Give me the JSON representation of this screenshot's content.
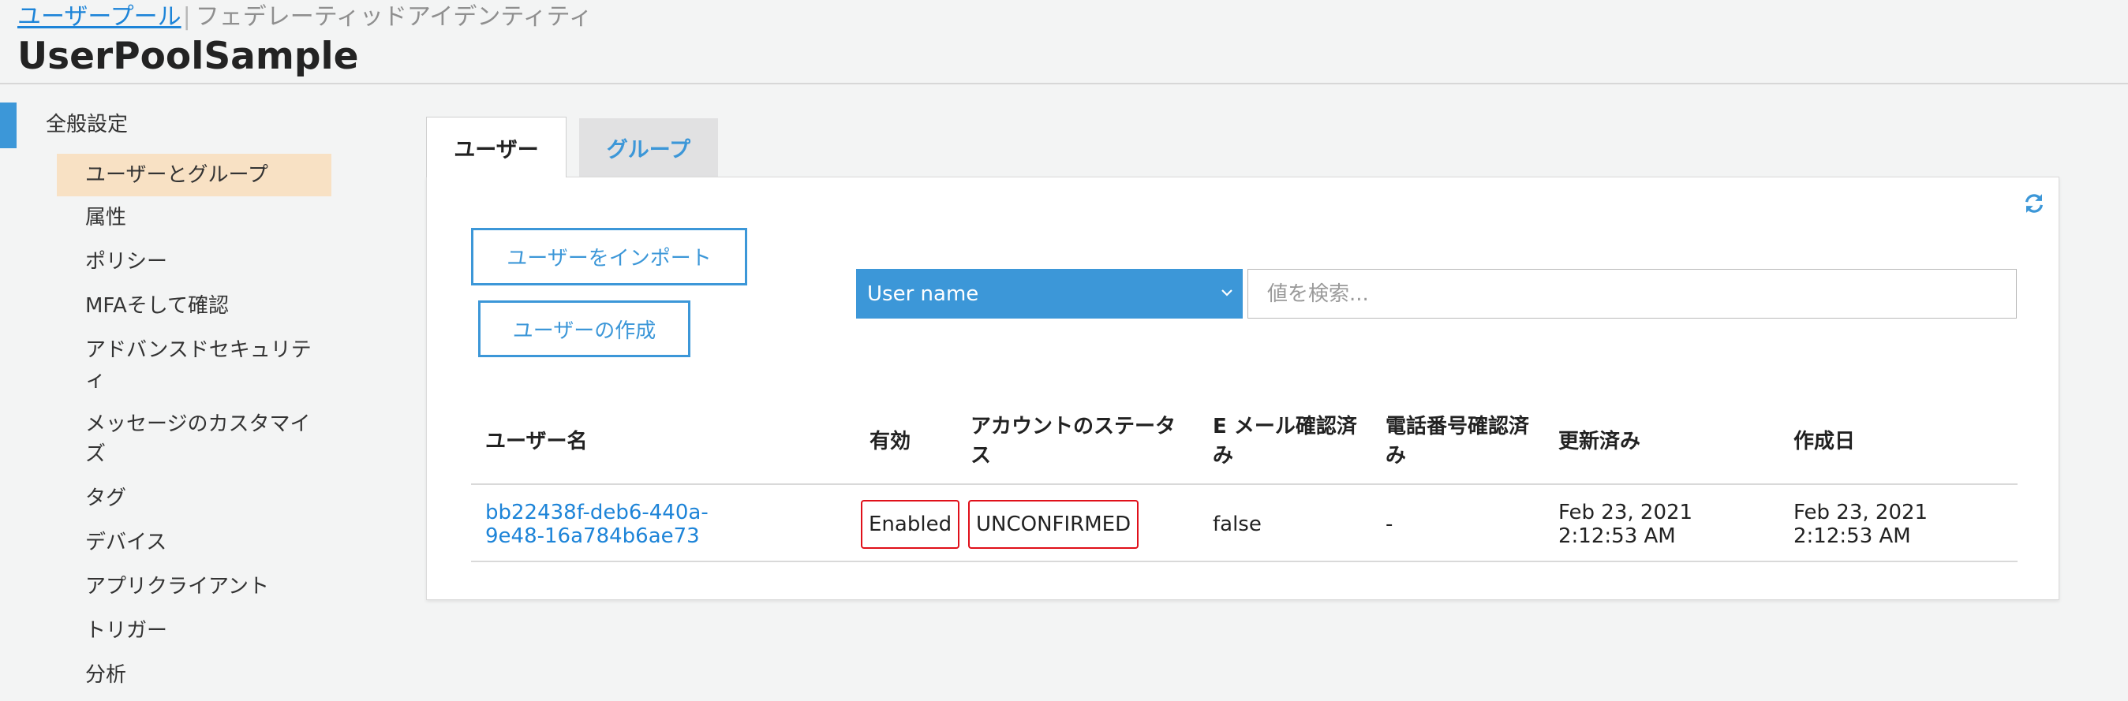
{
  "header": {
    "breadcrumb_link": "ユーザープール",
    "breadcrumb_current": "フェデレーティッドアイデンティティ",
    "title": "UserPoolSample"
  },
  "sidebar": {
    "heading": "全般設定",
    "items": [
      {
        "label": "ユーザーとグループ",
        "active": true
      },
      {
        "label": "属性"
      },
      {
        "label": "ポリシー"
      },
      {
        "label": "MFAそして確認"
      },
      {
        "label": "アドバンスドセキュリティ"
      },
      {
        "label": "メッセージのカスタマイズ"
      },
      {
        "label": "タグ"
      },
      {
        "label": "デバイス"
      },
      {
        "label": "アプリクライアント"
      },
      {
        "label": "トリガー"
      },
      {
        "label": "分析"
      }
    ]
  },
  "tabs": {
    "users": "ユーザー",
    "groups": "グループ"
  },
  "panel": {
    "refresh_icon": "refresh-icon",
    "import_button": "ユーザーをインポート",
    "create_button": "ユーザーの作成",
    "search_attribute": "User name",
    "search_placeholder": "値を検索..."
  },
  "table": {
    "columns": [
      "ユーザー名",
      "有効",
      "アカウントのステータス",
      "E メール確認済み",
      "電話番号確認済み",
      "更新済み",
      "作成日"
    ],
    "rows": [
      {
        "username": "bb22438f-deb6-440a-9e48-16a784b6ae73",
        "enabled": "Enabled",
        "status": "UNCONFIRMED",
        "email_verified": "false",
        "phone_verified": "-",
        "updated": "Feb 23, 2021 2:12:53 AM",
        "created": "Feb 23, 2021 2:12:53 AM"
      }
    ]
  },
  "colors": {
    "accent": "#3c97d8",
    "active_nav": "#f8e1c4",
    "highlight": "#e0101a",
    "link": "#1d84d8"
  }
}
